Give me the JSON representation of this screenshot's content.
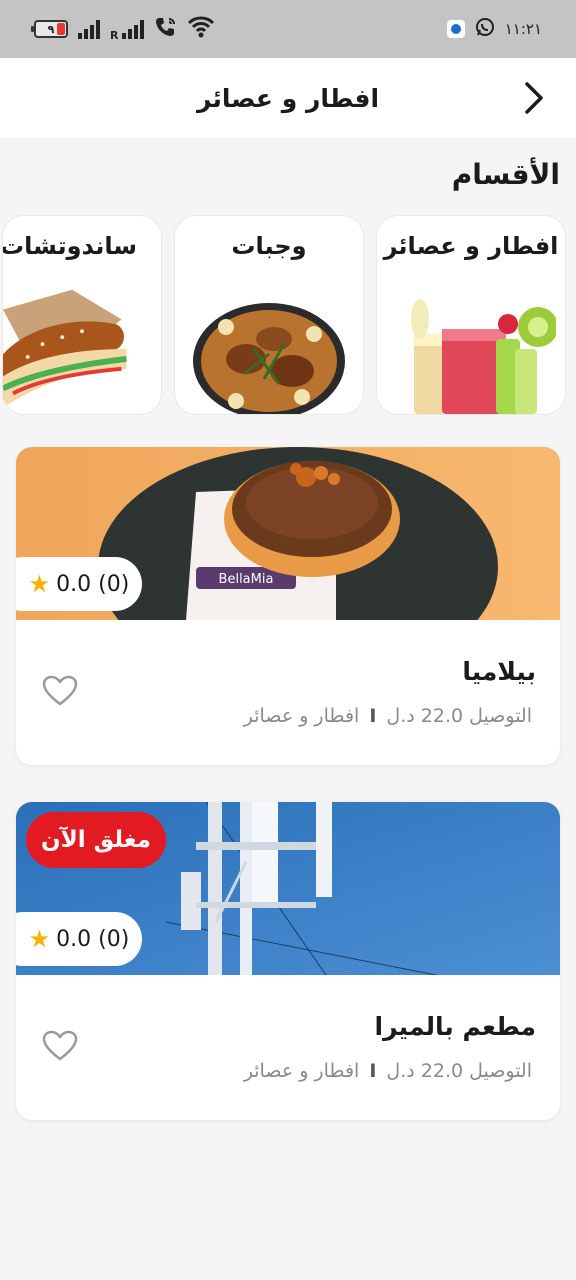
{
  "status_bar": {
    "time": "١١:٢١",
    "battery": "٩",
    "roaming_letter": "R",
    "icons": [
      "battery-icon",
      "signal-icon",
      "signal-roaming-icon",
      "wifi-calling-icon",
      "wifi-icon",
      "app-notification-icon",
      "whatsapp-icon"
    ]
  },
  "header": {
    "title": "افطار و عصائر",
    "back_icon": "chevron-right-icon"
  },
  "categories_section": {
    "title": "الأقسام",
    "items": [
      {
        "label": "افطار و عصائر",
        "image": "juices-image"
      },
      {
        "label": "وجبات",
        "image": "rice-chicken-image"
      },
      {
        "label": "ساندوتشات",
        "image": "sandwich-image"
      }
    ]
  },
  "restaurants": [
    {
      "name": "بيلاميا",
      "rating": "0.0 (0)",
      "delivery": "التوصيل 22.0 د.ل",
      "separator": "I",
      "category": "افطار و عصائر",
      "closed_label": "",
      "image": "donut-image",
      "image_text": "BellaMia"
    },
    {
      "name": "مطعم بالميرا",
      "rating": "0.0 (0)",
      "delivery": "التوصيل 22.0 د.ل",
      "separator": "I",
      "category": "افطار و عصائر",
      "closed_label": "مغلق الآن",
      "image": "antenna-tower-image"
    }
  ],
  "colors": {
    "accent_star": "#f5b301",
    "closed_badge": "#e21b23",
    "background": "#f5f5f5"
  }
}
